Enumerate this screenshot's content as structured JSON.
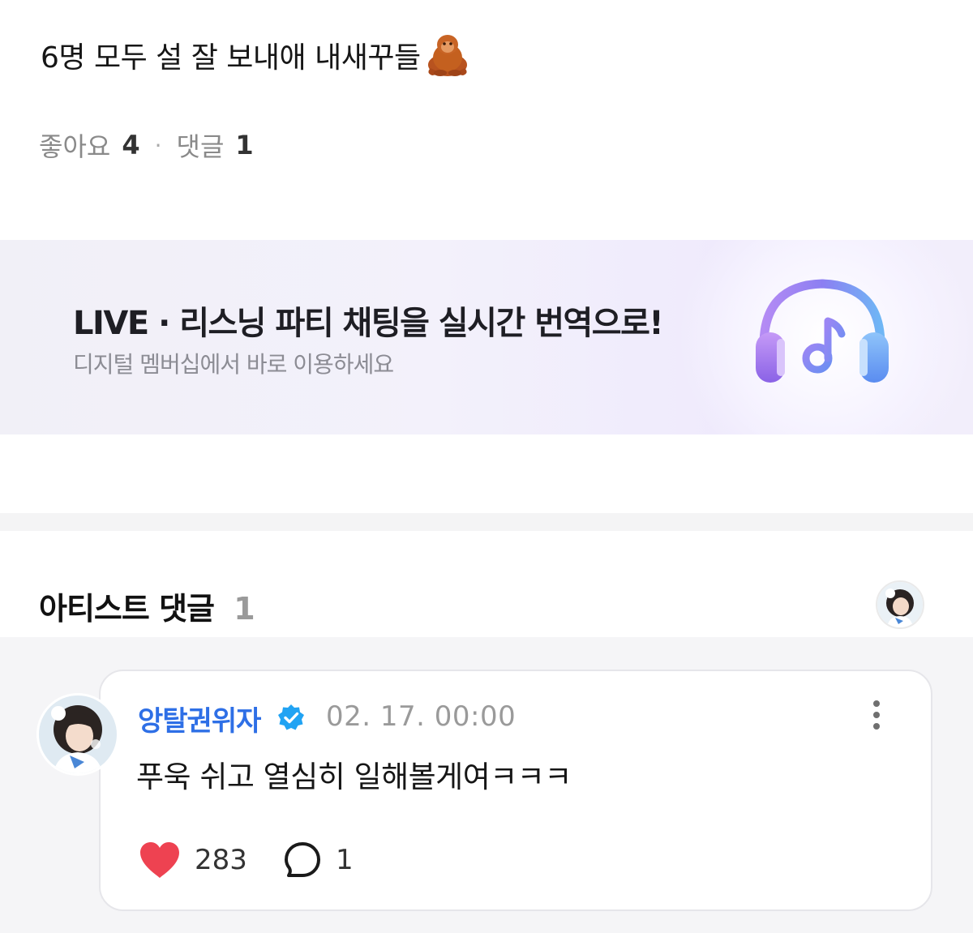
{
  "post": {
    "text": "6명 모두 설 잘 보내애 내새꾸들",
    "emoji": "orangutan-emoji",
    "likes_label": "좋아요",
    "likes_count": "4",
    "separator": "·",
    "comments_label": "댓글",
    "comments_count": "1"
  },
  "banner": {
    "title": "LIVE · 리스닝 파티 채팅을 실시간 번역으로!",
    "subtitle": "디지털 멤버십에서 바로 이용하세요",
    "icon": "headphones-music-icon"
  },
  "artist_comments": {
    "title": "아티스트 댓글",
    "count": "1"
  },
  "comment": {
    "author": "앙탈권위자",
    "timestamp": "02. 17. 00:00",
    "text": "푸욱 쉬고 열심히 일해볼게여ㅋㅋㅋ",
    "likes": "283",
    "replies": "1"
  },
  "colors": {
    "author": "#2e6fe6",
    "verified": "#21a3f3",
    "heart": "#ee4251",
    "banner_bg": "#f2f0fa"
  }
}
